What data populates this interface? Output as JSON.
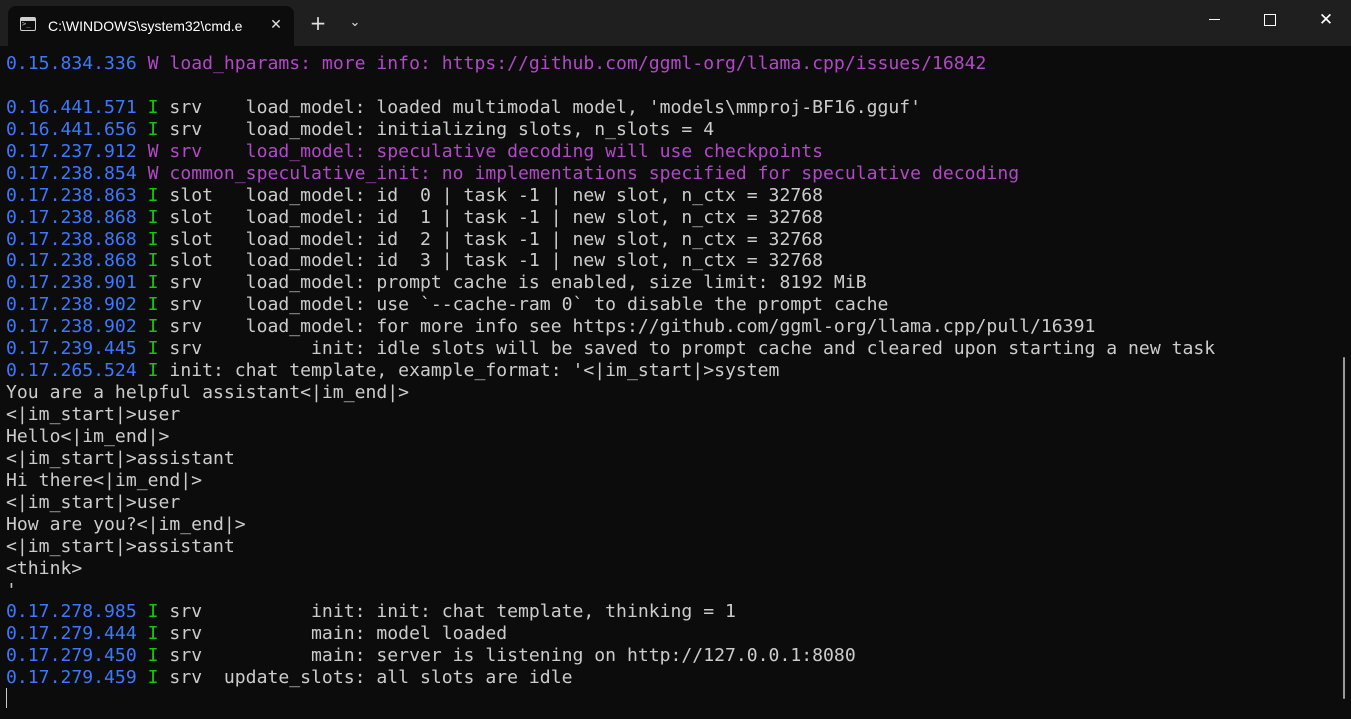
{
  "window": {
    "tab_title": "C:\\WINDOWS\\system32\\cmd.e",
    "tab_close": "✕",
    "new_tab": "+",
    "dropdown": "⌄",
    "close_glyph": "✕"
  },
  "colors": {
    "background": "#0c0c0c",
    "timestamp": "#3b78ff",
    "info": "#16c60c",
    "warning": "#b148c6",
    "text": "#cccccc"
  },
  "terminal": {
    "lines": [
      {
        "ts": "0.15.834.336",
        "lv": "W",
        "msg": " load_hparams: more info: https://github.com/ggml-org/llama.cpp/issues/16842"
      },
      {
        "msg": ""
      },
      {
        "ts": "0.16.441.571",
        "lv": "I",
        "msg": " srv    load_model: loaded multimodal model, 'models\\mmproj-BF16.gguf'"
      },
      {
        "ts": "0.16.441.656",
        "lv": "I",
        "msg": " srv    load_model: initializing slots, n_slots = 4"
      },
      {
        "ts": "0.17.237.912",
        "lv": "W",
        "msg": " srv    load_model: speculative decoding will use checkpoints"
      },
      {
        "ts": "0.17.238.854",
        "lv": "W",
        "msg": " common_speculative_init: no implementations specified for speculative decoding"
      },
      {
        "ts": "0.17.238.863",
        "lv": "I",
        "msg": " slot   load_model: id  0 | task -1 | new slot, n_ctx = 32768"
      },
      {
        "ts": "0.17.238.868",
        "lv": "I",
        "msg": " slot   load_model: id  1 | task -1 | new slot, n_ctx = 32768"
      },
      {
        "ts": "0.17.238.868",
        "lv": "I",
        "msg": " slot   load_model: id  2 | task -1 | new slot, n_ctx = 32768"
      },
      {
        "ts": "0.17.238.868",
        "lv": "I",
        "msg": " slot   load_model: id  3 | task -1 | new slot, n_ctx = 32768"
      },
      {
        "ts": "0.17.238.901",
        "lv": "I",
        "msg": " srv    load_model: prompt cache is enabled, size limit: 8192 MiB"
      },
      {
        "ts": "0.17.238.902",
        "lv": "I",
        "msg": " srv    load_model: use `--cache-ram 0` to disable the prompt cache"
      },
      {
        "ts": "0.17.238.902",
        "lv": "I",
        "msg": " srv    load_model: for more info see https://github.com/ggml-org/llama.cpp/pull/16391"
      },
      {
        "ts": "0.17.239.445",
        "lv": "I",
        "msg": " srv          init: idle slots will be saved to prompt cache and cleared upon starting a new task"
      },
      {
        "ts": "0.17.265.524",
        "lv": "I",
        "msg": " init: chat template, example_format: '<|im_start|>system"
      },
      {
        "msg": "You are a helpful assistant<|im_end|>"
      },
      {
        "msg": "<|im_start|>user"
      },
      {
        "msg": "Hello<|im_end|>"
      },
      {
        "msg": "<|im_start|>assistant"
      },
      {
        "msg": "Hi there<|im_end|>"
      },
      {
        "msg": "<|im_start|>user"
      },
      {
        "msg": "How are you?<|im_end|>"
      },
      {
        "msg": "<|im_start|>assistant"
      },
      {
        "msg": "<think>"
      },
      {
        "msg": "'"
      },
      {
        "ts": "0.17.278.985",
        "lv": "I",
        "msg": " srv          init: init: chat template, thinking = 1"
      },
      {
        "ts": "0.17.279.444",
        "lv": "I",
        "msg": " srv          main: model loaded"
      },
      {
        "ts": "0.17.279.450",
        "lv": "I",
        "msg": " srv          main: server is listening on http://127.0.0.1:8080"
      },
      {
        "ts": "0.17.279.459",
        "lv": "I",
        "msg": " srv  update_slots: all slots are idle"
      }
    ]
  }
}
